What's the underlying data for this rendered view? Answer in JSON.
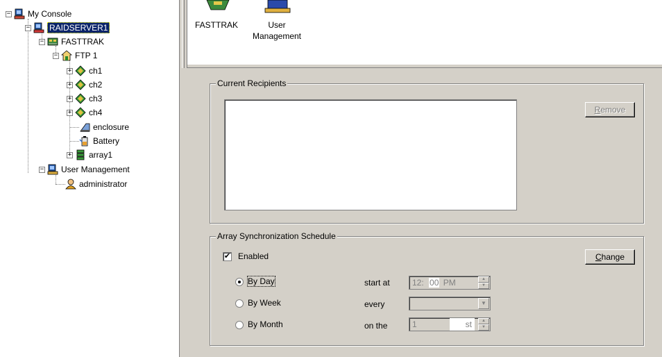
{
  "tree": {
    "root": "My Console",
    "server": "RAIDSERVER1",
    "fasttrak": "FASTTRAK",
    "ftp": "FTP 1",
    "channels": [
      "ch1",
      "ch2",
      "ch3",
      "ch4"
    ],
    "enclosure": "enclosure",
    "battery": "Battery",
    "array": "array1",
    "user_mgmt": "User Management",
    "admin": "administrator"
  },
  "toolbar": {
    "fasttrak_label": "FASTTRAK",
    "user_label_1": "User",
    "user_label_2": "Management"
  },
  "recipients": {
    "legend": "Current Recipients",
    "remove_pre": "",
    "remove_u": "R",
    "remove_post": "emove"
  },
  "schedule": {
    "legend": "Array Synchronization Schedule",
    "enabled_label": "Enabled",
    "change_u": "C",
    "change_post": "hange",
    "by_day": "By Day",
    "by_week": "By Week",
    "by_month": "By Month",
    "start_at": "start at",
    "every": "every",
    "on_the": "on the",
    "hour": "12",
    "minute": "00",
    "ampm": "PM",
    "day_value": "1",
    "day_suffix": "st"
  },
  "colors": {
    "selection": "#0a246a",
    "panel": "#d4d0c8"
  }
}
